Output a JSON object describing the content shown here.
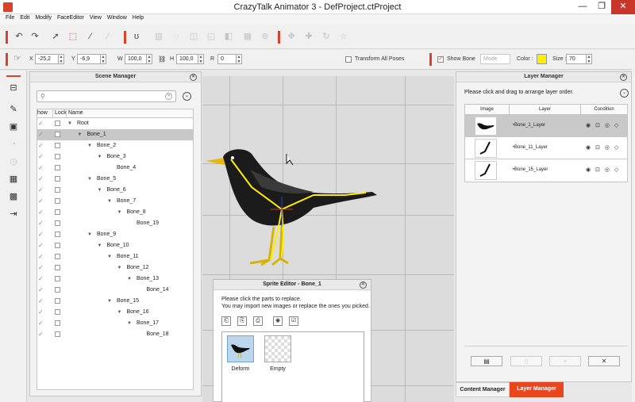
{
  "window": {
    "title": "CrazyTalk Animator 3  -  DefProject.ctProject",
    "minimize": "—",
    "maximize": "❐",
    "close": "✕"
  },
  "menu": [
    "File",
    "Edit",
    "Modify",
    "FaceEditor",
    "View",
    "Window",
    "Help"
  ],
  "transform": {
    "x_label": "X",
    "x_value": "-25,2",
    "y_label": "Y",
    "y_value": "-6,9",
    "w_label": "W",
    "w_value": "100,0",
    "h_label": "H",
    "h_value": "100,0",
    "r_label": "R",
    "r_value": "0",
    "transform_all_label": "Transform All Poses",
    "show_bone_label": "Show Bone",
    "mode_value": "Mode",
    "color_label": "Color :",
    "bone_color": "#ffee00",
    "size_label": "Size :",
    "size_value": "70"
  },
  "scene_manager": {
    "title": "Scene Manager",
    "search_placeholder": "",
    "columns": [
      "how",
      "Lock",
      "Name"
    ],
    "rows": [
      {
        "name": "Root",
        "depth": 0,
        "arrow": "▼"
      },
      {
        "name": "Bone_1",
        "depth": 1,
        "arrow": "▼",
        "selected": true
      },
      {
        "name": "Bone_2",
        "depth": 2,
        "arrow": "▼"
      },
      {
        "name": "Bone_3",
        "depth": 3,
        "arrow": "▼"
      },
      {
        "name": "Bone_4",
        "depth": 4,
        "arrow": ""
      },
      {
        "name": "Bone_5",
        "depth": 2,
        "arrow": "▼"
      },
      {
        "name": "Bone_6",
        "depth": 3,
        "arrow": "▼"
      },
      {
        "name": "Bone_7",
        "depth": 4,
        "arrow": "▼"
      },
      {
        "name": "Bone_8",
        "depth": 5,
        "arrow": "▼"
      },
      {
        "name": "Bone_19",
        "depth": 6,
        "arrow": ""
      },
      {
        "name": "Bone_9",
        "depth": 2,
        "arrow": "▼"
      },
      {
        "name": "Bone_10",
        "depth": 3,
        "arrow": "▼"
      },
      {
        "name": "Bone_11",
        "depth": 4,
        "arrow": "▼"
      },
      {
        "name": "Bone_12",
        "depth": 5,
        "arrow": "▼"
      },
      {
        "name": "Bone_13",
        "depth": 6,
        "arrow": "▼"
      },
      {
        "name": "Bone_14",
        "depth": 7,
        "arrow": ""
      },
      {
        "name": "Bone_15",
        "depth": 4,
        "arrow": "▼"
      },
      {
        "name": "Bone_16",
        "depth": 5,
        "arrow": "▼"
      },
      {
        "name": "Bone_17",
        "depth": 6,
        "arrow": "▼"
      },
      {
        "name": "Bone_18",
        "depth": 7,
        "arrow": ""
      }
    ]
  },
  "layer_manager": {
    "title": "Layer Manager",
    "hint": "Please click and drag to arrange layer order.",
    "columns": [
      "Image",
      "Layer",
      "Condition"
    ],
    "layers": [
      {
        "name": "Bone_1_Layer",
        "selected": true
      },
      {
        "name": "Bone_11_Layer",
        "selected": false
      },
      {
        "name": "Bone_15_Layer",
        "selected": false
      }
    ],
    "buttons": [
      "▤",
      "▯",
      "+",
      "✕"
    ]
  },
  "bottom_tabs": {
    "content_manager": "Content Manager",
    "layer_manager": "Layer Manager"
  },
  "sprite_editor": {
    "title": "Sprite Editor - Bone_1",
    "line1": "Please click the parts to replace.",
    "line2": "You may import new images or replace the ones you picked.",
    "items": [
      {
        "label": "Deform"
      },
      {
        "label": "Empty"
      }
    ]
  },
  "colors": {
    "accent": "#d9432b",
    "active_tab": "#e8461f",
    "bone": "#ffee00"
  }
}
